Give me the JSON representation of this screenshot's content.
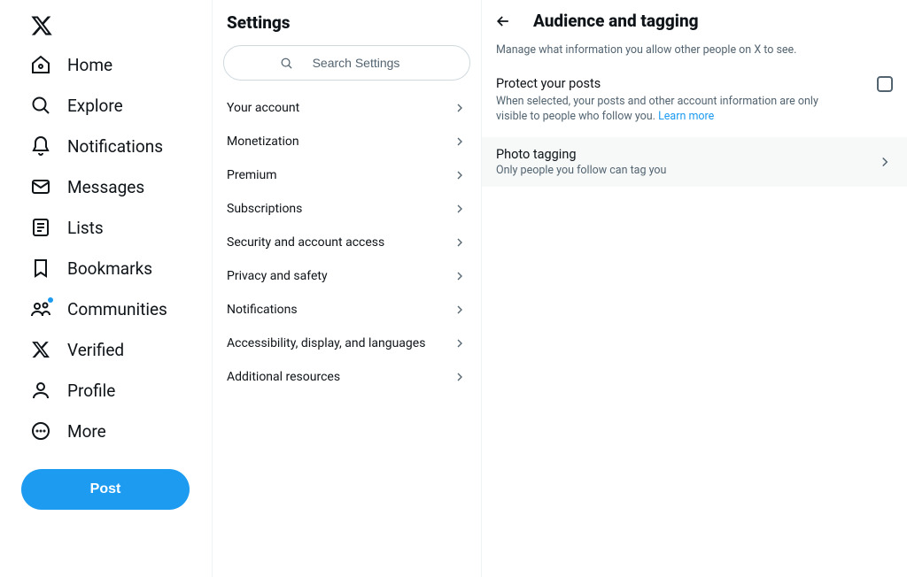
{
  "nav": {
    "items": [
      {
        "label": "Home",
        "icon": "home-icon"
      },
      {
        "label": "Explore",
        "icon": "search-icon"
      },
      {
        "label": "Notifications",
        "icon": "bell-icon"
      },
      {
        "label": "Messages",
        "icon": "mail-icon"
      },
      {
        "label": "Lists",
        "icon": "list-icon"
      },
      {
        "label": "Bookmarks",
        "icon": "bookmark-icon"
      },
      {
        "label": "Communities",
        "icon": "communities-icon",
        "has_dot": true
      },
      {
        "label": "Verified",
        "icon": "x-icon"
      },
      {
        "label": "Profile",
        "icon": "profile-icon"
      },
      {
        "label": "More",
        "icon": "more-icon"
      }
    ],
    "post_label": "Post"
  },
  "settings": {
    "title": "Settings",
    "search_placeholder": "Search Settings",
    "items": [
      {
        "label": "Your account"
      },
      {
        "label": "Monetization"
      },
      {
        "label": "Premium"
      },
      {
        "label": "Subscriptions"
      },
      {
        "label": "Security and account access"
      },
      {
        "label": "Privacy and safety"
      },
      {
        "label": "Notifications"
      },
      {
        "label": "Accessibility, display, and languages"
      },
      {
        "label": "Additional resources"
      }
    ]
  },
  "detail": {
    "title": "Audience and tagging",
    "subtitle": "Manage what information you allow other people on X to see.",
    "protect": {
      "title": "Protect your posts",
      "desc": "When selected, your posts and other account information are only visible to people who follow you. ",
      "learn_more": "Learn more",
      "checked": false
    },
    "photo_tagging": {
      "title": "Photo tagging",
      "subtitle": "Only people you follow can tag you"
    }
  }
}
